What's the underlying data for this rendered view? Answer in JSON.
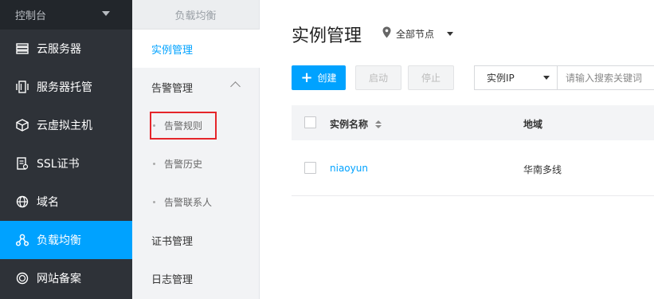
{
  "console": {
    "label": "控制台"
  },
  "sidebar": {
    "items": [
      {
        "label": "云服务器",
        "icon": "server-list-icon"
      },
      {
        "label": "服务器托管",
        "icon": "server-rack-icon"
      },
      {
        "label": "云虚拟主机",
        "icon": "cube-icon"
      },
      {
        "label": "SSL证书",
        "icon": "certificate-icon"
      },
      {
        "label": "域名",
        "icon": "globe-icon"
      },
      {
        "label": "负载均衡",
        "icon": "load-balance-icon",
        "active": true
      },
      {
        "label": "网站备案",
        "icon": "record-badge-icon"
      }
    ]
  },
  "submenu": {
    "header": "负载均衡",
    "instance": "实例管理",
    "alarm": "告警管理",
    "alarm_rules": "告警规则",
    "alarm_history": "告警历史",
    "alarm_contacts": "告警联系人",
    "cert": "证书管理",
    "log": "日志管理"
  },
  "main": {
    "title": "实例管理",
    "region": "全部节点",
    "buttons": {
      "create": "创建",
      "start": "启动",
      "stop": "停止"
    },
    "search": {
      "field": "实例IP",
      "placeholder": "请输入搜索关键词"
    },
    "table": {
      "headers": {
        "name": "实例名称",
        "region": "地域"
      },
      "rows": [
        {
          "name": "niaoyun",
          "region": "华南多线"
        }
      ]
    }
  },
  "colors": {
    "accent": "#00a2ff",
    "sidebar_bg": "#2e3238",
    "highlight": "#e5252a"
  }
}
